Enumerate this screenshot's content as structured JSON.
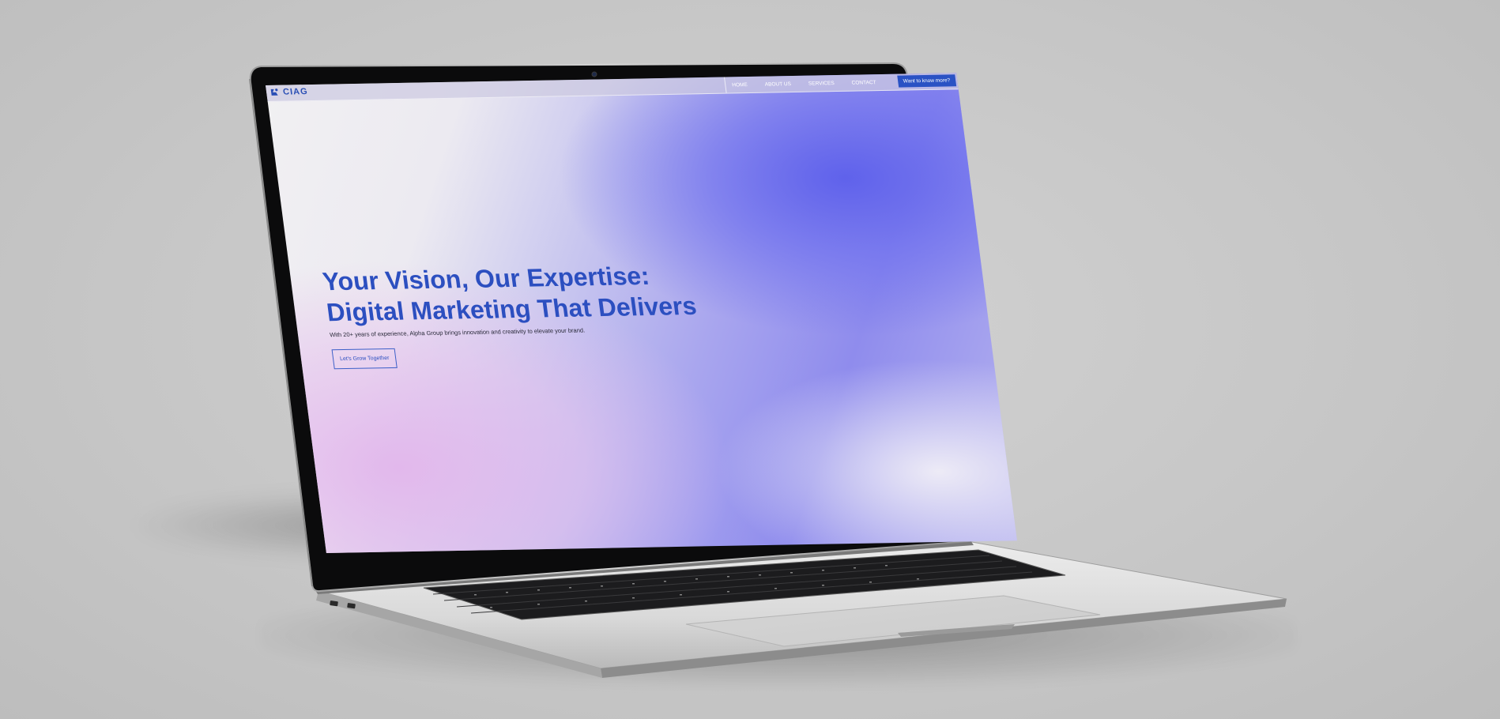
{
  "site": {
    "logo_text": "CIAG",
    "nav": {
      "links": [
        "HOME",
        "ABOUT US",
        "SERVICES",
        "CONTACT"
      ],
      "cta": "Want to know more?"
    },
    "hero": {
      "title_line1": "Your Vision, Our Expertise:",
      "title_line2": "Digital Marketing That Delivers",
      "subtitle": "With 20+ years of experience, Alpha Group brings innovation and creativity to elevate your brand.",
      "button": "Let's Grow Together"
    }
  },
  "colors": {
    "brand_blue": "#2c4fc0",
    "cta_blue": "#2a52c4",
    "gradient_violet": "#5c5feb",
    "gradient_pink": "#e2b6ec",
    "background": "#c6c6c6"
  },
  "icons": {
    "logo": "ciag-logo-mark",
    "camera": "webcam"
  }
}
